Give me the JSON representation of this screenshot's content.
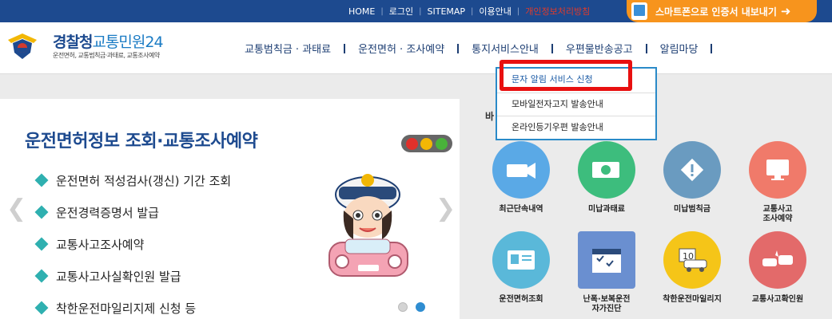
{
  "topnav": {
    "items": [
      "HOME",
      "로그인",
      "SITEMAP",
      "이용안내",
      "개인정보처리방침"
    ],
    "smart_label": "스마트폰으로 인증서 내보내기"
  },
  "logo": {
    "title_a": "경찰청",
    "title_b": "교통민원24",
    "subtitle": "운전면허, 교통범칙금·과태료, 교통조사예약"
  },
  "mainnav": {
    "items": [
      "교통범칙금 · 과태료",
      "운전면허 · 조사예약",
      "통지서비스안내",
      "우편물반송공고",
      "알림마당"
    ]
  },
  "dropdown": {
    "items": [
      "문자 알림 서비스 신청",
      "모바일전자고지 발송안내",
      "온라인등기우편 발송안내"
    ]
  },
  "banner": {
    "title": "운전면허정보 조회·교통조사예약",
    "items": [
      "운전면허 적성검사(갱신) 기간 조회",
      "운전경력증명서 발급",
      "교통사고조사예약",
      "교통사고사실확인원 발급",
      "착한운전마일리지제 신청 등"
    ]
  },
  "right": {
    "section_label": "바",
    "services": [
      {
        "label": "최근단속내역",
        "color": "#5aa9e6",
        "icon": "camera-icon"
      },
      {
        "label": "미납과태료",
        "color": "#3dbd7d",
        "icon": "money-icon"
      },
      {
        "label": "미납범칙금",
        "color": "#6a9bc0",
        "icon": "warning-icon"
      },
      {
        "label": "교통사고\n조사예약",
        "color": "#f07a6a",
        "icon": "computer-icon"
      },
      {
        "label": "운전면허조회",
        "color": "#5ab8d9",
        "icon": "license-icon"
      },
      {
        "label": "난폭·보복운전\n자가진단",
        "color": "#6a8fd0",
        "icon": "calendar-icon"
      },
      {
        "label": "착한운전마일리지",
        "color": "#f5c518",
        "icon": "mileage-icon"
      },
      {
        "label": "교통사고확인원",
        "color": "#e36a6a",
        "icon": "crash-icon"
      }
    ]
  },
  "colors": {
    "topbar": "#1d4a8f",
    "smart_btn": "#f7941d",
    "highlight": "#e81010",
    "accent": "#2fb0b0"
  }
}
